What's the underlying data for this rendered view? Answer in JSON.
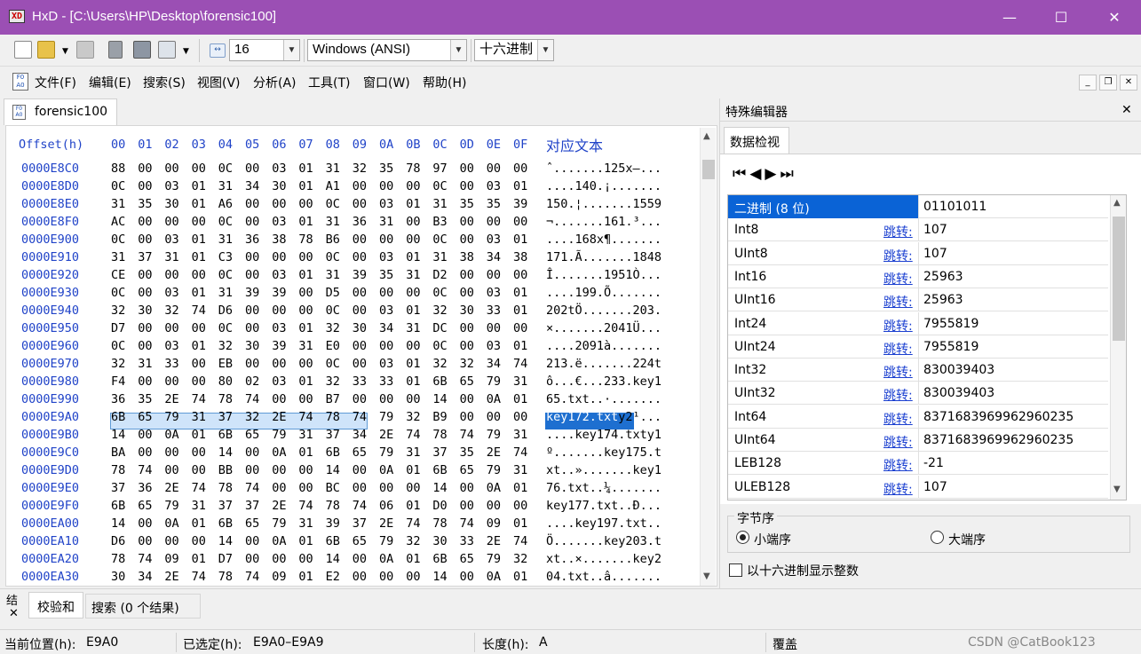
{
  "window": {
    "title": "HxD - [C:\\Users\\HP\\Desktop\\forensic100]",
    "minimize": "—",
    "maximize": "☐",
    "close": "✕",
    "app_icon": "hxd-icon"
  },
  "toolbar": {
    "bytes_per_row": "16",
    "charset": "Windows (ANSI)",
    "offset_base": "十六进制"
  },
  "menu": [
    "文件(F)",
    "编辑(E)",
    "搜索(S)",
    "视图(V)",
    "分析(A)",
    "工具(T)",
    "窗口(W)",
    "帮助(H)"
  ],
  "document_tab": "forensic100",
  "hex": {
    "offset_header": "Offset(h)",
    "column_headers": [
      "00",
      "01",
      "02",
      "03",
      "04",
      "05",
      "06",
      "07",
      "08",
      "09",
      "0A",
      "0B",
      "0C",
      "0D",
      "0E",
      "0F"
    ],
    "text_header": "对应文本",
    "rows": [
      {
        "offset": "0000E8C0",
        "bytes": [
          "88",
          "00",
          "00",
          "00",
          "0C",
          "00",
          "03",
          "01",
          "31",
          "32",
          "35",
          "78",
          "97",
          "00",
          "00",
          "00"
        ],
        "text": "ˆ.......125x—..."
      },
      {
        "offset": "0000E8D0",
        "bytes": [
          "0C",
          "00",
          "03",
          "01",
          "31",
          "34",
          "30",
          "01",
          "A1",
          "00",
          "00",
          "00",
          "0C",
          "00",
          "03",
          "01"
        ],
        "text": "....140.¡......."
      },
      {
        "offset": "0000E8E0",
        "bytes": [
          "31",
          "35",
          "30",
          "01",
          "A6",
          "00",
          "00",
          "00",
          "0C",
          "00",
          "03",
          "01",
          "31",
          "35",
          "35",
          "39"
        ],
        "text": "150.¦.......1559"
      },
      {
        "offset": "0000E8F0",
        "bytes": [
          "AC",
          "00",
          "00",
          "00",
          "0C",
          "00",
          "03",
          "01",
          "31",
          "36",
          "31",
          "00",
          "B3",
          "00",
          "00",
          "00"
        ],
        "text": "¬.......161.³..."
      },
      {
        "offset": "0000E900",
        "bytes": [
          "0C",
          "00",
          "03",
          "01",
          "31",
          "36",
          "38",
          "78",
          "B6",
          "00",
          "00",
          "00",
          "0C",
          "00",
          "03",
          "01"
        ],
        "text": "....168x¶......."
      },
      {
        "offset": "0000E910",
        "bytes": [
          "31",
          "37",
          "31",
          "01",
          "C3",
          "00",
          "00",
          "00",
          "0C",
          "00",
          "03",
          "01",
          "31",
          "38",
          "34",
          "38"
        ],
        "text": "171.Ã.......1848"
      },
      {
        "offset": "0000E920",
        "bytes": [
          "CE",
          "00",
          "00",
          "00",
          "0C",
          "00",
          "03",
          "01",
          "31",
          "39",
          "35",
          "31",
          "D2",
          "00",
          "00",
          "00"
        ],
        "text": "Î.......1951Ò..."
      },
      {
        "offset": "0000E930",
        "bytes": [
          "0C",
          "00",
          "03",
          "01",
          "31",
          "39",
          "39",
          "00",
          "D5",
          "00",
          "00",
          "00",
          "0C",
          "00",
          "03",
          "01"
        ],
        "text": "....199.Õ......."
      },
      {
        "offset": "0000E940",
        "bytes": [
          "32",
          "30",
          "32",
          "74",
          "D6",
          "00",
          "00",
          "00",
          "0C",
          "00",
          "03",
          "01",
          "32",
          "30",
          "33",
          "01"
        ],
        "text": "202tÖ.......203."
      },
      {
        "offset": "0000E950",
        "bytes": [
          "D7",
          "00",
          "00",
          "00",
          "0C",
          "00",
          "03",
          "01",
          "32",
          "30",
          "34",
          "31",
          "DC",
          "00",
          "00",
          "00"
        ],
        "text": "×.......2041Ü..."
      },
      {
        "offset": "0000E960",
        "bytes": [
          "0C",
          "00",
          "03",
          "01",
          "32",
          "30",
          "39",
          "31",
          "E0",
          "00",
          "00",
          "00",
          "0C",
          "00",
          "03",
          "01"
        ],
        "text": "....2091à......."
      },
      {
        "offset": "0000E970",
        "bytes": [
          "32",
          "31",
          "33",
          "00",
          "EB",
          "00",
          "00",
          "00",
          "0C",
          "00",
          "03",
          "01",
          "32",
          "32",
          "34",
          "74"
        ],
        "text": "213.ë.......224t"
      },
      {
        "offset": "0000E980",
        "bytes": [
          "F4",
          "00",
          "00",
          "00",
          "80",
          "02",
          "03",
          "01",
          "32",
          "33",
          "33",
          "01",
          "6B",
          "65",
          "79",
          "31"
        ],
        "text": "ô...€...233.key1"
      },
      {
        "offset": "0000E990",
        "bytes": [
          "36",
          "35",
          "2E",
          "74",
          "78",
          "74",
          "00",
          "00",
          "B7",
          "00",
          "00",
          "00",
          "14",
          "00",
          "0A",
          "01"
        ],
        "text": "65.txt..·......."
      },
      {
        "offset": "0000E9A0",
        "bytes": [
          "6B",
          "65",
          "79",
          "31",
          "37",
          "32",
          "2E",
          "74",
          "78",
          "74",
          "79",
          "32",
          "B9",
          "00",
          "00",
          "00"
        ],
        "text_selected": "key172.txt",
        "text": "y2¹..."
      },
      {
        "offset": "0000E9B0",
        "bytes": [
          "14",
          "00",
          "0A",
          "01",
          "6B",
          "65",
          "79",
          "31",
          "37",
          "34",
          "2E",
          "74",
          "78",
          "74",
          "79",
          "31"
        ],
        "text": "....key174.txty1"
      },
      {
        "offset": "0000E9C0",
        "bytes": [
          "BA",
          "00",
          "00",
          "00",
          "14",
          "00",
          "0A",
          "01",
          "6B",
          "65",
          "79",
          "31",
          "37",
          "35",
          "2E",
          "74"
        ],
        "text": "º.......key175.t"
      },
      {
        "offset": "0000E9D0",
        "bytes": [
          "78",
          "74",
          "00",
          "00",
          "BB",
          "00",
          "00",
          "00",
          "14",
          "00",
          "0A",
          "01",
          "6B",
          "65",
          "79",
          "31"
        ],
        "text": "xt..».......key1"
      },
      {
        "offset": "0000E9E0",
        "bytes": [
          "37",
          "36",
          "2E",
          "74",
          "78",
          "74",
          "00",
          "00",
          "BC",
          "00",
          "00",
          "00",
          "14",
          "00",
          "0A",
          "01"
        ],
        "text": "76.txt..¼......."
      },
      {
        "offset": "0000E9F0",
        "bytes": [
          "6B",
          "65",
          "79",
          "31",
          "37",
          "37",
          "2E",
          "74",
          "78",
          "74",
          "06",
          "01",
          "D0",
          "00",
          "00",
          "00"
        ],
        "text": "key177.txt..Ð..."
      },
      {
        "offset": "0000EA00",
        "bytes": [
          "14",
          "00",
          "0A",
          "01",
          "6B",
          "65",
          "79",
          "31",
          "39",
          "37",
          "2E",
          "74",
          "78",
          "74",
          "09",
          "01"
        ],
        "text": "....key197.txt.."
      },
      {
        "offset": "0000EA10",
        "bytes": [
          "D6",
          "00",
          "00",
          "00",
          "14",
          "00",
          "0A",
          "01",
          "6B",
          "65",
          "79",
          "32",
          "30",
          "33",
          "2E",
          "74"
        ],
        "text": "Ö.......key203.t"
      },
      {
        "offset": "0000EA20",
        "bytes": [
          "78",
          "74",
          "09",
          "01",
          "D7",
          "00",
          "00",
          "00",
          "14",
          "00",
          "0A",
          "01",
          "6B",
          "65",
          "79",
          "32"
        ],
        "text": "xt..×.......key2"
      },
      {
        "offset": "0000EA30",
        "bytes": [
          "30",
          "34",
          "2E",
          "74",
          "78",
          "74",
          "09",
          "01",
          "E2",
          "00",
          "00",
          "00",
          "14",
          "00",
          "0A",
          "01"
        ],
        "text": "04.txt..â......."
      }
    ]
  },
  "special_editor": {
    "title": "特殊编辑器",
    "close": "✕",
    "tab": "数据检视",
    "rows": [
      {
        "name": "二进制 (8 位)",
        "jump": "",
        "value": "01101011",
        "selected": true
      },
      {
        "name": "Int8",
        "jump": "跳转:",
        "value": "107"
      },
      {
        "name": "UInt8",
        "jump": "跳转:",
        "value": "107"
      },
      {
        "name": "Int16",
        "jump": "跳转:",
        "value": "25963"
      },
      {
        "name": "UInt16",
        "jump": "跳转:",
        "value": "25963"
      },
      {
        "name": "Int24",
        "jump": "跳转:",
        "value": "7955819"
      },
      {
        "name": "UInt24",
        "jump": "跳转:",
        "value": "7955819"
      },
      {
        "name": "Int32",
        "jump": "跳转:",
        "value": "830039403"
      },
      {
        "name": "UInt32",
        "jump": "跳转:",
        "value": "830039403"
      },
      {
        "name": "Int64",
        "jump": "跳转:",
        "value": "8371683969962960235"
      },
      {
        "name": "UInt64",
        "jump": "跳转:",
        "value": "8371683969962960235"
      },
      {
        "name": "LEB128",
        "jump": "跳转:",
        "value": "-21"
      },
      {
        "name": "ULEB128",
        "jump": "跳转:",
        "value": "107"
      }
    ],
    "byte_order_label": "字节序",
    "little_endian": "小端序",
    "big_endian": "大端序",
    "hex_ints": "以十六进制显示整数"
  },
  "bottom_tabs": {
    "stub": "结",
    "close": "✕",
    "checksum": "校验和",
    "search": "搜索 (0 个结果)"
  },
  "status": {
    "position_label": "当前位置(h):",
    "position": "E9A0",
    "selected_label": "已选定(h):",
    "selected": "E9A0–E9A9",
    "length_label": "长度(h):",
    "length": "A",
    "mode": "覆盖"
  },
  "watermark": "CSDN @CatBook123",
  "colors": {
    "titlebar": "#9b4fb4",
    "offset_blue": "#2043c8",
    "selection_fill": "#cfe4fa",
    "selected_row": "#0a63d6"
  }
}
